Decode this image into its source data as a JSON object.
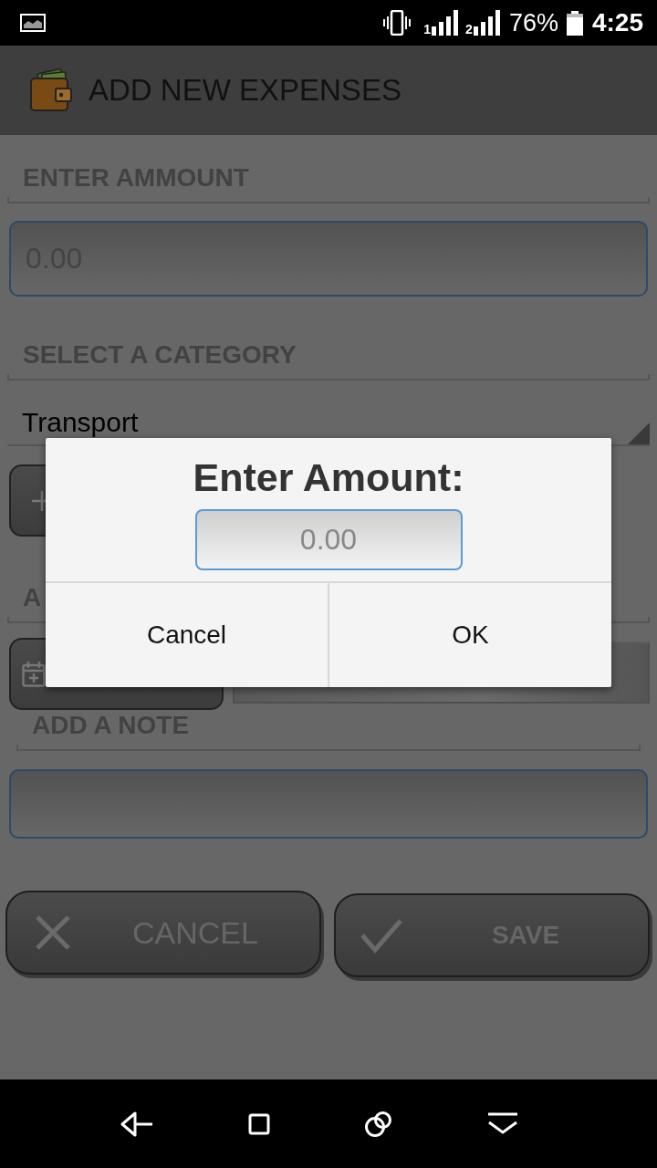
{
  "status_bar": {
    "sims": [
      {
        "number": "1"
      },
      {
        "number": "2"
      }
    ],
    "battery_percent": "76%",
    "time": "4:25"
  },
  "app_bar": {
    "title": "ADD NEW EXPENSES"
  },
  "form": {
    "amount": {
      "label": "ENTER AMMOUNT",
      "placeholder": "0.00"
    },
    "category": {
      "label": "SELECT A CATEGORY",
      "value": "Transport"
    },
    "section_3": {
      "label": "A"
    },
    "note": {
      "label": "ADD A NOTE"
    },
    "actions": [
      {
        "kind": "cancel",
        "label": "CANCEL"
      },
      {
        "kind": "save",
        "label": "SAVE"
      }
    ]
  },
  "dialog": {
    "title": "Enter Amount:",
    "field": {
      "placeholder": "0.00"
    },
    "buttons": [
      "Cancel",
      "OK"
    ]
  }
}
